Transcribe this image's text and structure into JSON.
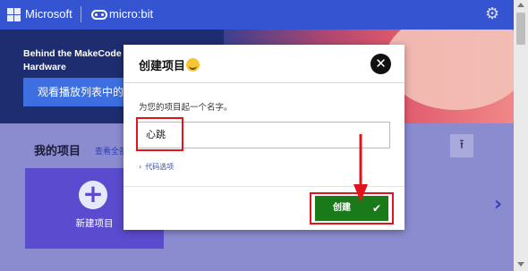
{
  "topbar": {
    "brand": "Microsoft",
    "product": "micro:bit",
    "settings_icon": "gear-icon"
  },
  "hero": {
    "title": "Behind the MakeCode Hardware",
    "playlist_button": "观看播放列表中的"
  },
  "projects": {
    "title": "我的项目",
    "view_all": "查看全部",
    "new_project": "新建项目"
  },
  "dialog": {
    "title": "创建项目",
    "prompt": "为您的项目起一个名字。",
    "name_value": "心跳",
    "code_options": "代码选项",
    "create_button": "创建"
  },
  "colors": {
    "topbar": "#3454d1",
    "highlight": "#e0141b",
    "create_button": "#1a7a1a",
    "new_project_card": "#5b4bcf"
  }
}
